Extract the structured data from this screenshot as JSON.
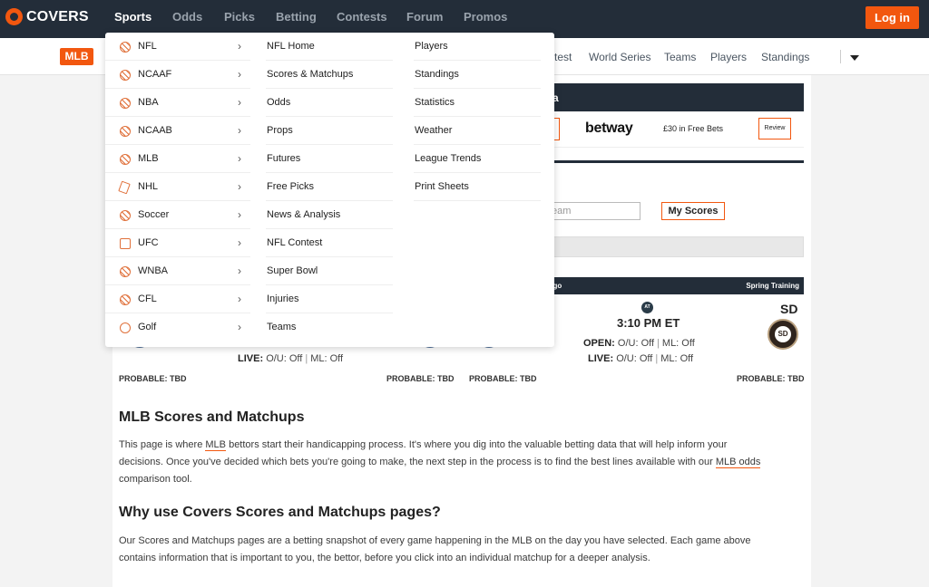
{
  "brand": {
    "name": "COVERS"
  },
  "topnav": {
    "links": [
      "Sports",
      "Odds",
      "Picks",
      "Betting",
      "Contests",
      "Forum",
      "Promos"
    ],
    "login_label": "Log in"
  },
  "subnav": {
    "sport": "MLB",
    "links": [
      "test",
      "World Series",
      "Teams",
      "Players",
      "Standings"
    ]
  },
  "dropdown": {
    "sports": [
      "NFL",
      "NCAAF",
      "NBA",
      "NCAAB",
      "MLB",
      "NHL",
      "Soccer",
      "UFC",
      "WNBA",
      "CFL",
      "Golf"
    ],
    "col2": [
      "NFL Home",
      "Scores & Matchups",
      "Odds",
      "Props",
      "Futures",
      "Free Picks",
      "News & Analysis",
      "NFL Contest",
      "Super Bowl",
      "Injuries",
      "Teams"
    ],
    "col3": [
      "Players",
      "Standings",
      "Statistics",
      "Weather",
      "League Trends",
      "Print Sheets"
    ]
  },
  "sidebar_promo": {
    "header_tail": "a",
    "book": "betway",
    "offer": "£30 in Free Bets",
    "review_label": "Review"
  },
  "scores": {
    "team_placeholder": "eam",
    "my_scores_label": "My Scores",
    "game_header_left": "ego",
    "game_header_right": "Spring Training",
    "at_label": "AT",
    "time": "3:10 PM ET",
    "home_abbr": "SD",
    "home_logo_text": "SD",
    "open_label": "OPEN:",
    "live_label": "LIVE:",
    "ou_off": "O/U: Off",
    "ml_off": "ML: Off",
    "probable": "PROBABLE: TBD"
  },
  "article": {
    "h1": "MLB Scores and Matchups",
    "p1_a": "This page is where ",
    "p1_link1": "MLB",
    "p1_b": " bettors start their handicapping process. It's where you dig into the valuable betting data that will help inform your",
    "p1_c": "decisions. Once you've decided which bets you're going to make, the next step in the process is to find the best lines available with our ",
    "p1_link2": "MLB odds",
    "p1_d": "comparison tool.",
    "h2": "Why use Covers Scores and Matchups pages?",
    "p2_line1": "Our Scores and Matchups pages are a betting snapshot of every game happening in the MLB on the day you have selected. Each game above",
    "p2_line2": "contains information that is important to you, the bettor, before you click into an individual matchup for a deeper analysis."
  }
}
